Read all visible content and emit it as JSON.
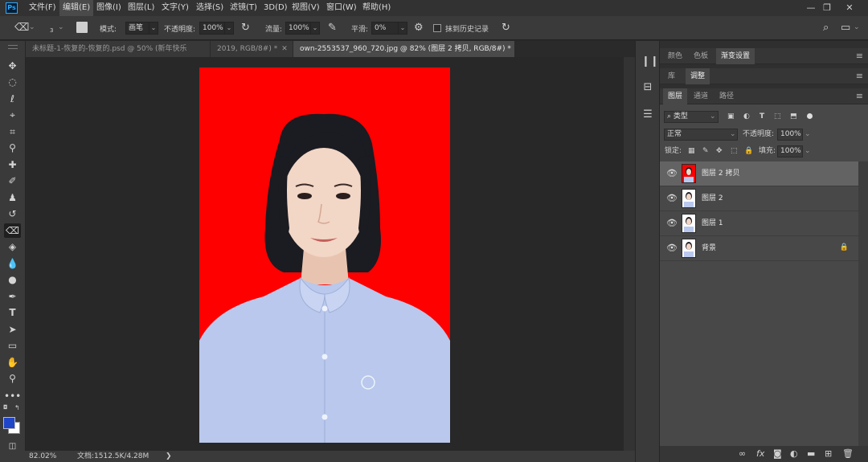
{
  "app": {
    "logo": "Ps"
  },
  "menu": [
    "文件(F)",
    "编辑(E)",
    "图像(I)",
    "图层(L)",
    "文字(Y)",
    "选择(S)",
    "滤镜(T)",
    "3D(D)",
    "视图(V)",
    "窗口(W)",
    "帮助(H)"
  ],
  "window_controls": {
    "minimize": "—",
    "restore": "❐",
    "close": "✕"
  },
  "options": {
    "tool_icon": "eraser-icon",
    "brush_size": "3",
    "mode_label": "模式:",
    "mode_value": "画笔",
    "opacity_label": "不透明度:",
    "opacity_value": "100%",
    "flow_label": "流量:",
    "flow_value": "100%",
    "smooth_label": "平滑:",
    "smooth_value": "0%",
    "history_label": "抹到历史记录"
  },
  "tabs": [
    {
      "label": "未标题-1-恢复的-恢复的.psd @ 50% (新年快乐",
      "active": false
    },
    {
      "label": "2019, RGB/8#) *",
      "active": false
    },
    {
      "label": "own-2553537_960_720.jpg @ 82% (图层 2 拷贝, RGB/8#) *",
      "active": true
    }
  ],
  "status": {
    "zoom": "82.02%",
    "doc": "文档:1512.5K/4.28M",
    "arrow": "❯"
  },
  "panels": {
    "top_tabs": [
      "颜色",
      "色板",
      "渐变设置"
    ],
    "mid_tabs": [
      "库",
      "调整"
    ],
    "layer_tabs": [
      "图层",
      "通道",
      "路径"
    ],
    "filter_kind": "类型",
    "blend_mode": "正常",
    "opacity_label": "不透明度:",
    "opacity_value": "100%",
    "lock_label": "锁定:",
    "fill_label": "填充:",
    "fill_value": "100%"
  },
  "layers": [
    {
      "name": "图层 2 拷贝",
      "thumb": "red",
      "selected": true,
      "locked": false
    },
    {
      "name": "图层 2",
      "thumb": "white",
      "selected": false,
      "locked": false
    },
    {
      "name": "图层 1",
      "thumb": "white",
      "selected": false,
      "locked": false
    },
    {
      "name": "背景",
      "thumb": "white",
      "selected": false,
      "locked": true
    }
  ],
  "colors": {
    "foreground": "#1f45c8",
    "background": "#ffffff",
    "photo_background": "#ff0000",
    "accent": "#31a8ff"
  }
}
